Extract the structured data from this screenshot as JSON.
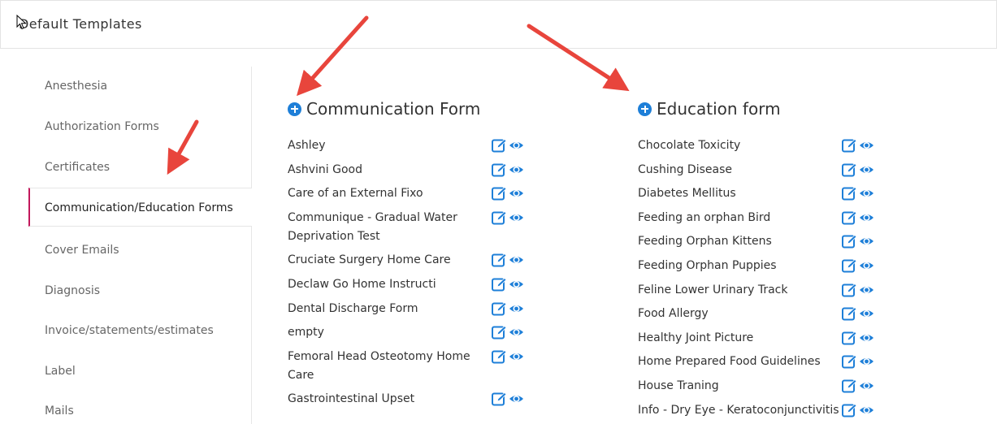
{
  "header": {
    "title": "Default Templates"
  },
  "sidebar": {
    "items": [
      {
        "label": "Anesthesia",
        "active": false
      },
      {
        "label": "Authorization Forms",
        "active": false
      },
      {
        "label": "Certificates",
        "active": false
      },
      {
        "label": "Communication/Education Forms",
        "active": true
      },
      {
        "label": "Cover Emails",
        "active": false
      },
      {
        "label": "Diagnosis",
        "active": false
      },
      {
        "label": "Invoice/statements/estimates",
        "active": false
      },
      {
        "label": "Label",
        "active": false
      },
      {
        "label": "Mails",
        "active": false
      }
    ]
  },
  "communication": {
    "title": "Communication Form",
    "items": [
      {
        "label": "Ashley"
      },
      {
        "label": "Ashvini Good"
      },
      {
        "label": "Care of an External Fixo"
      },
      {
        "label": "Communique - Gradual Water\nDeprivation Test"
      },
      {
        "label": "Cruciate Surgery Home Care"
      },
      {
        "label": "Declaw Go Home Instructi"
      },
      {
        "label": "Dental Discharge Form"
      },
      {
        "label": "empty"
      },
      {
        "label": "Femoral Head Osteotomy Home\nCare"
      },
      {
        "label": "Gastrointestinal Upset"
      }
    ]
  },
  "education": {
    "title": "Education form",
    "items": [
      {
        "label": "Chocolate Toxicity"
      },
      {
        "label": "Cushing Disease"
      },
      {
        "label": "Diabetes Mellitus"
      },
      {
        "label": "Feeding an orphan Bird"
      },
      {
        "label": "Feeding Orphan Kittens"
      },
      {
        "label": "Feeding Orphan Puppies"
      },
      {
        "label": "Feline Lower Urinary Track"
      },
      {
        "label": "Food Allergy"
      },
      {
        "label": "Healthy Joint Picture"
      },
      {
        "label": "Home Prepared Food Guidelines"
      },
      {
        "label": "House Traning"
      },
      {
        "label": "Info - Dry Eye - Keratoconjunctivitis"
      }
    ]
  },
  "colors": {
    "accent": "#1e7fd8",
    "active_border": "#c2185b",
    "arrow": "#e8453c"
  }
}
